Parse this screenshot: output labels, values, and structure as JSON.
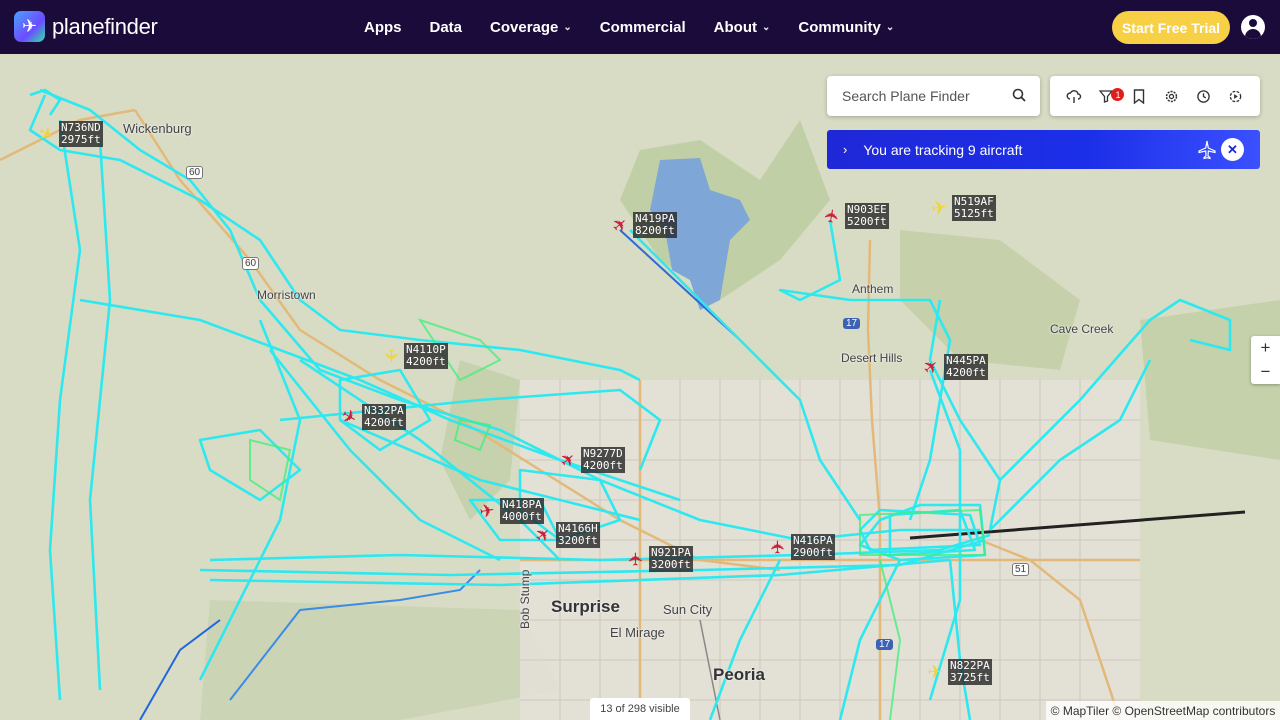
{
  "header": {
    "logo_text": "planefinder",
    "nav": [
      {
        "label": "Apps",
        "dropdown": false
      },
      {
        "label": "Data",
        "dropdown": false
      },
      {
        "label": "Coverage",
        "dropdown": true
      },
      {
        "label": "Commercial",
        "dropdown": false
      },
      {
        "label": "About",
        "dropdown": true
      },
      {
        "label": "Community",
        "dropdown": true
      }
    ],
    "trial_button": "Start Free Trial"
  },
  "search": {
    "placeholder": "Search Plane Finder"
  },
  "toolbar": {
    "buttons": [
      "weather-icon",
      "filter-icon",
      "bookmark-icon",
      "settings-icon",
      "history-icon",
      "playback-icon"
    ],
    "filter_badge": "1"
  },
  "tracking": {
    "text": "You are tracking 9 aircraft"
  },
  "zoom": {
    "in": "+",
    "out": "−"
  },
  "status": {
    "visible": "13 of 298 visible"
  },
  "attribution": "© MapTiler © OpenStreetMap contributors",
  "places": {
    "wickenburg": "Wickenburg",
    "morristown": "Morristown",
    "anthem": "Anthem",
    "desert_hills": "Desert Hills",
    "cave_creek": "Cave Creek",
    "surprise": "Surprise",
    "sun_city": "Sun City",
    "el_mirage": "El Mirage",
    "peoria": "Peoria",
    "bob_stump": "Bob Stump",
    "hwy60a": "60",
    "hwy60b": "60",
    "hwy17a": "17",
    "hwy17b": "17",
    "hwy51": "51"
  },
  "aircraft": [
    {
      "reg": "N736ND",
      "alt": "2975ft",
      "color": "#f1d33a"
    },
    {
      "reg": "N419PA",
      "alt": "8200ft",
      "color": "#c8203a"
    },
    {
      "reg": "N903EE",
      "alt": "5200ft",
      "color": "#c8203a"
    },
    {
      "reg": "N519AF",
      "alt": "5125ft",
      "color": "#f1d33a"
    },
    {
      "reg": "N4110P",
      "alt": "4200ft",
      "color": "#f1d33a"
    },
    {
      "reg": "N332PA",
      "alt": "4200ft",
      "color": "#c8203a"
    },
    {
      "reg": "N445PA",
      "alt": "4200ft",
      "color": "#c8203a"
    },
    {
      "reg": "N9277D",
      "alt": "4200ft",
      "color": "#c8203a"
    },
    {
      "reg": "N418PA",
      "alt": "4000ft",
      "color": "#c8203a"
    },
    {
      "reg": "N4166H",
      "alt": "3200ft",
      "color": "#c8203a"
    },
    {
      "reg": "N921PA",
      "alt": "3200ft",
      "color": "#c8203a"
    },
    {
      "reg": "N416PA",
      "alt": "2900ft",
      "color": "#c8203a"
    },
    {
      "reg": "N822PA",
      "alt": "3725ft",
      "color": "#f1d33a"
    }
  ],
  "colors": {
    "header_bg": "#1b0b3a",
    "trial_bg": "#f7d046",
    "track": "#2ee8f0",
    "tracking_bar": "#1f28d8"
  }
}
